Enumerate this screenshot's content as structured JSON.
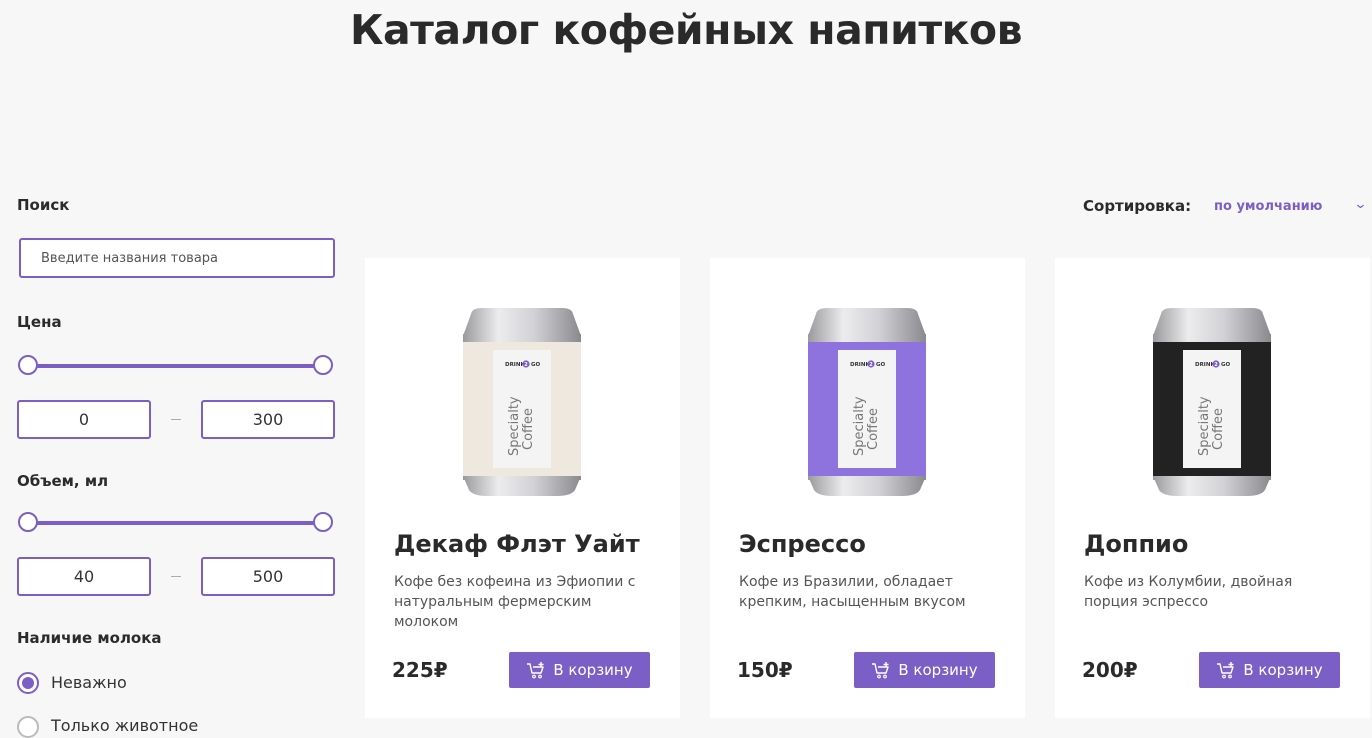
{
  "page": {
    "title": "Каталог кофейных напитков"
  },
  "filters": {
    "search": {
      "label": "Поиск",
      "placeholder": "Введите названия товара",
      "value": ""
    },
    "price": {
      "label": "Цена",
      "min": "0",
      "max": "300"
    },
    "volume": {
      "label": "Объем, мл",
      "min": "40",
      "max": "500"
    },
    "milk": {
      "label": "Наличие молока",
      "options": [
        {
          "label": "Неважно",
          "checked": true
        },
        {
          "label": "Только животное",
          "checked": false
        }
      ]
    }
  },
  "sort": {
    "label": "Сортировка:",
    "value": "по умолчанию",
    "icon": "chevron-down-icon"
  },
  "products": [
    {
      "name": "Декаф Флэт Уайт",
      "description": "Кофе без кофеина из Эфиопии с натуральным фермерским молоком",
      "price": "225₽",
      "button": "В корзину",
      "can_color": "#efe8df",
      "can_text": "Specialty Coffee",
      "brand": "DRINK 2 GO"
    },
    {
      "name": "Эспрессо",
      "description": "Кофе из Бразилии, обладает крепким, насыщенным вкусом",
      "price": "150₽",
      "button": "В корзину",
      "can_color": "#8e72de",
      "can_text": "Specialty Coffee",
      "brand": "DRINK 2 GO"
    },
    {
      "name": "Доппио",
      "description": "Кофе из Колумбии, двойная порция эспрессо",
      "price": "200₽",
      "button": "В корзину",
      "can_color": "#222222",
      "can_text": "Specialty Coffee",
      "brand": "DRINK 2 GO"
    }
  ],
  "colors": {
    "accent": "#7b5fc7",
    "background": "#f7f7f8"
  }
}
